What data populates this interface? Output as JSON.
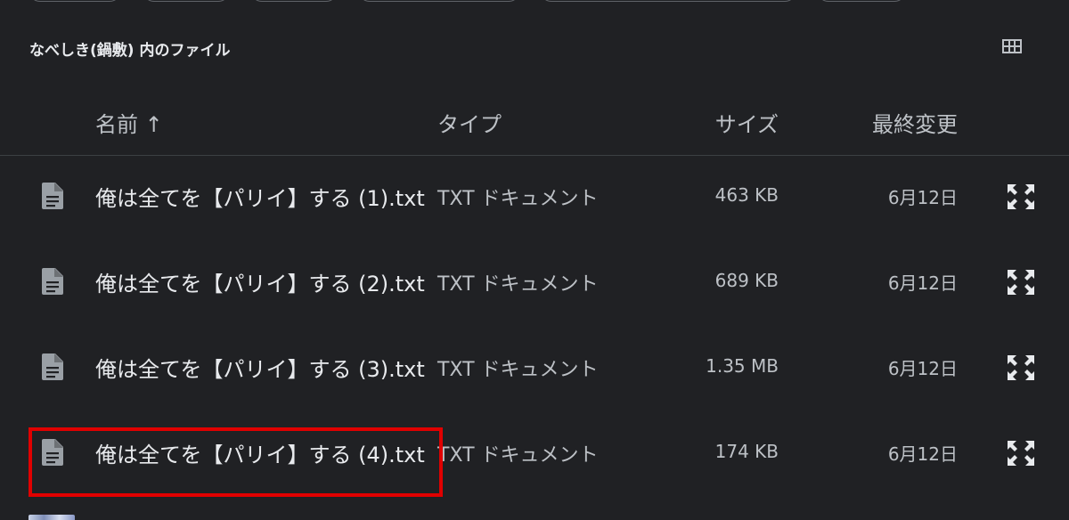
{
  "folder_title": "なべしき(鍋敷) 内のファイル",
  "columns": {
    "name": "名前 ↑",
    "type": "タイプ",
    "size": "サイズ",
    "modified": "最終変更"
  },
  "files": [
    {
      "name": "俺は全てを【パリイ】する (1).txt",
      "type": "TXT ドキュメント",
      "size": "463 KB",
      "modified": "6月12日"
    },
    {
      "name": "俺は全てを【パリイ】する (2).txt",
      "type": "TXT ドキュメント",
      "size": "689 KB",
      "modified": "6月12日"
    },
    {
      "name": "俺は全てを【パリイ】する (3).txt",
      "type": "TXT ドキュメント",
      "size": "1.35 MB",
      "modified": "6月12日"
    },
    {
      "name": "俺は全てを【パリイ】する (4).txt",
      "type": "TXT ドキュメント",
      "size": "174 KB",
      "modified": "6月12日"
    }
  ],
  "icons": {
    "file": "text-file-icon",
    "view_toggle": "grid-view-icon",
    "open": "expand-icon"
  },
  "colors": {
    "background": "#202124",
    "highlight": "#e00000"
  }
}
